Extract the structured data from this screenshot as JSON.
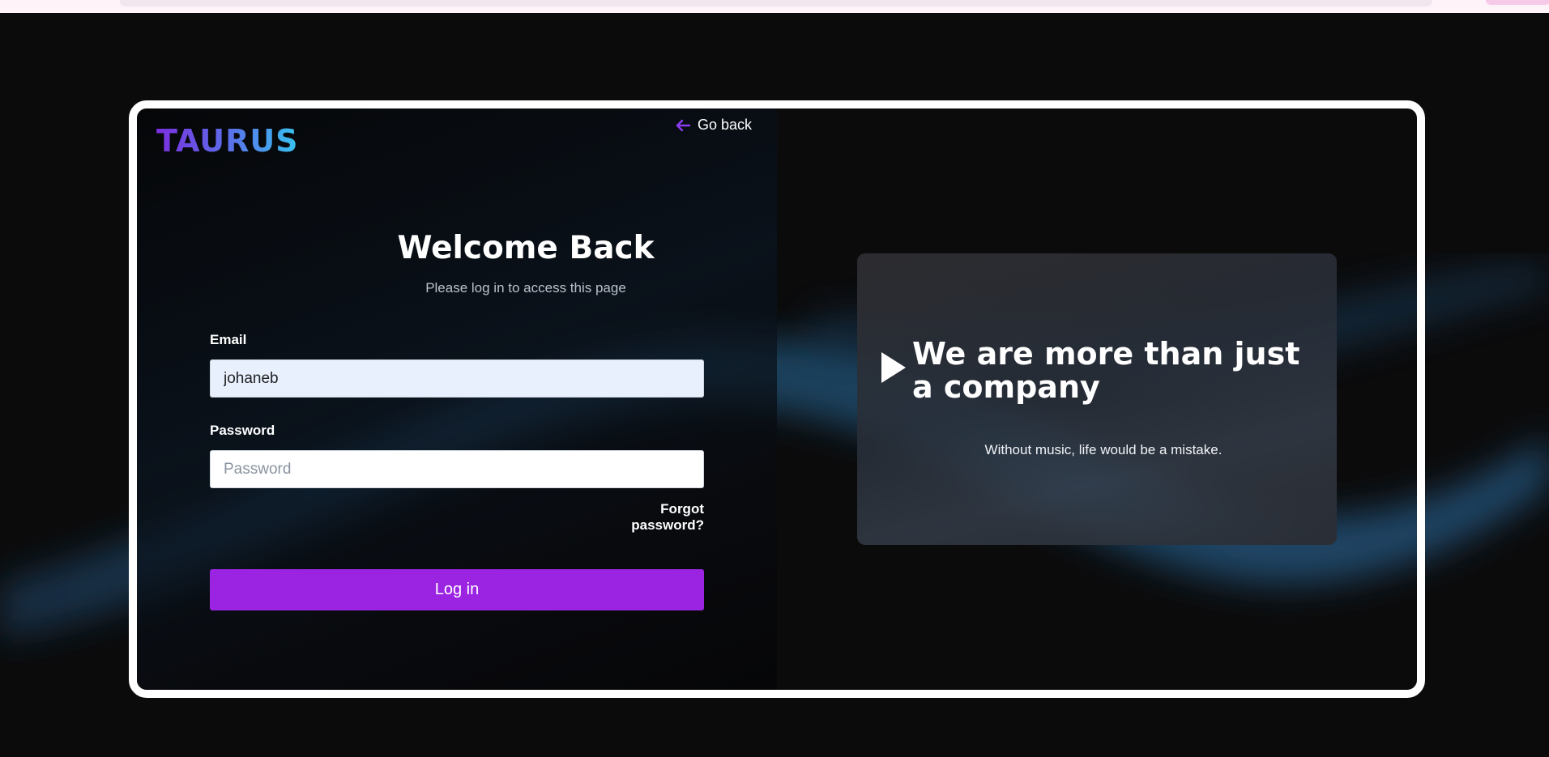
{
  "brand": {
    "logo_text": "TAURUS"
  },
  "nav": {
    "go_back_label": "Go back"
  },
  "login": {
    "title": "Welcome Back",
    "subtitle": "Please log in to access this page",
    "email_label": "Email",
    "email_value": "johaneb",
    "password_label": "Password",
    "password_placeholder": "Password",
    "forgot_label": "Forgot password?",
    "submit_label": "Log in"
  },
  "promo": {
    "heading": "We are more than just a company",
    "quote": "Without music, life would be a mistake."
  },
  "colors": {
    "accent": "#9b23e2",
    "logo_gradient_start": "#7b2fe0",
    "logo_gradient_end": "#38c3f0",
    "background": "#0b0b0c",
    "frame": "#ffffff"
  },
  "icons": {
    "back": "arrow-left-icon",
    "play": "play-icon"
  }
}
